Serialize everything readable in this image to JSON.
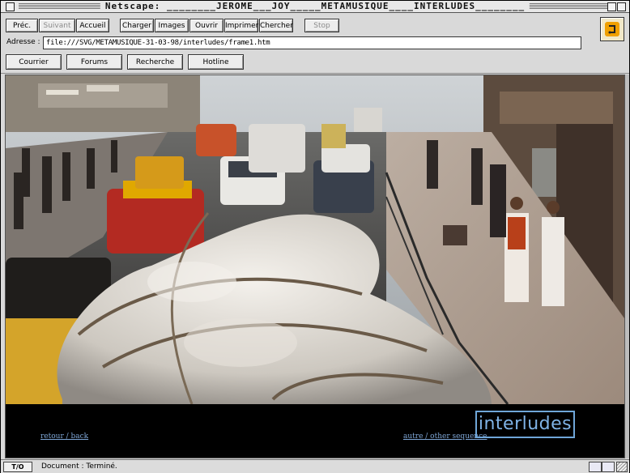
{
  "window": {
    "title": "Netscape: ________JEROME___JOY_____METAMUSIQUE____INTERLUDES________"
  },
  "toolbar": {
    "prec": "Préc.",
    "suivant": "Suivant",
    "accueil": "Accueil",
    "charger": "Charger",
    "images": "Images",
    "ouvrir": "Ouvrir",
    "imprimer": "Imprimer",
    "chercher": "Chercher",
    "stop": "Stop"
  },
  "address": {
    "label": "Adresse :",
    "value": "file:///SVG/METAMUSIQUE-31-03-98/interludes/frame1.htm"
  },
  "directory": {
    "courrier": "Courrier",
    "forums": "Forums",
    "recherche": "Recherche",
    "hotline": "Hotline"
  },
  "page": {
    "link_back": "retour / back",
    "link_other": "autre / other sequence",
    "brand": "interludes"
  },
  "status": {
    "icons_label": "T/O",
    "text": "Document : Terminé."
  },
  "colors": {
    "link": "#7ea6d6",
    "brand": "#7fb3e6",
    "page_bg": "#000000"
  }
}
